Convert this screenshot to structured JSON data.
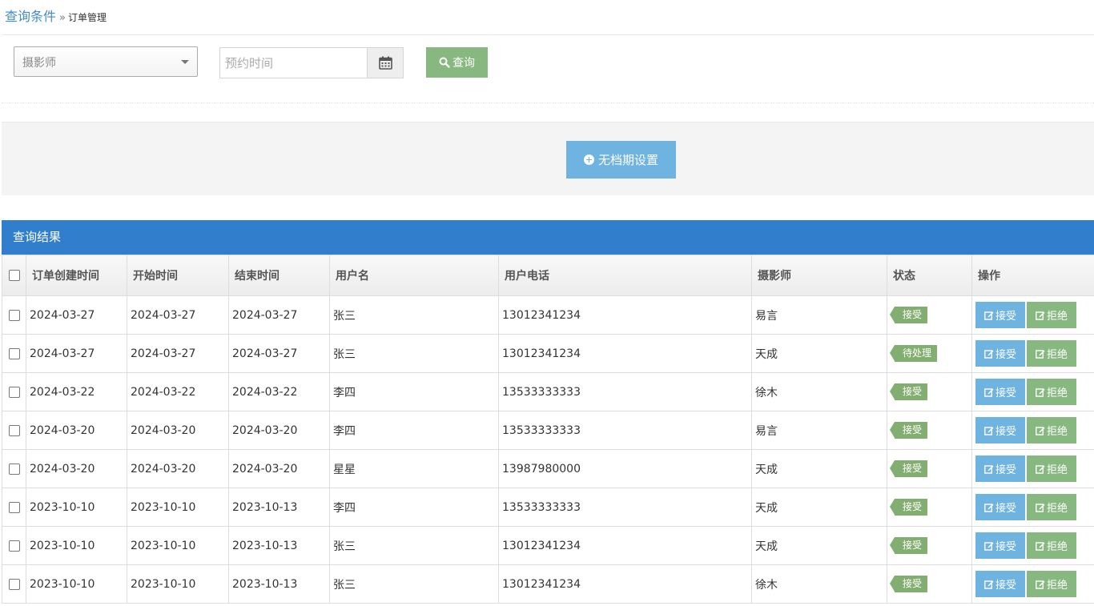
{
  "breadcrumb": {
    "main": "查询条件",
    "separator": "»",
    "sub": "订单管理"
  },
  "search": {
    "photographer_select": "摄影师",
    "date_placeholder": "预约时间",
    "query_label": "查询"
  },
  "toolbar": {
    "no_schedule_label": "无档期设置"
  },
  "results": {
    "title": "查询结果",
    "columns": [
      "订单创建时间",
      "开始时间",
      "结束时间",
      "用户名",
      "用户电话",
      "摄影师",
      "状态",
      "操作"
    ],
    "accept_label": "接受",
    "reject_label": "拒绝",
    "rows": [
      {
        "created": "2024-03-27",
        "start": "2024-03-27",
        "end": "2024-03-27",
        "user": "张三",
        "phone": "13012341234",
        "photographer": "易言",
        "status": "接受"
      },
      {
        "created": "2024-03-27",
        "start": "2024-03-27",
        "end": "2024-03-27",
        "user": "张三",
        "phone": "13012341234",
        "photographer": "天成",
        "status": "待处理"
      },
      {
        "created": "2024-03-22",
        "start": "2024-03-22",
        "end": "2024-03-22",
        "user": "李四",
        "phone": "13533333333",
        "photographer": "徐木",
        "status": "接受"
      },
      {
        "created": "2024-03-20",
        "start": "2024-03-20",
        "end": "2024-03-20",
        "user": "李四",
        "phone": "13533333333",
        "photographer": "易言",
        "status": "接受"
      },
      {
        "created": "2024-03-20",
        "start": "2024-03-20",
        "end": "2024-03-20",
        "user": "星星",
        "phone": "13987980000",
        "photographer": "天成",
        "status": "接受"
      },
      {
        "created": "2023-10-10",
        "start": "2023-10-10",
        "end": "2023-10-13",
        "user": "李四",
        "phone": "13533333333",
        "photographer": "天成",
        "status": "接受"
      },
      {
        "created": "2023-10-10",
        "start": "2023-10-10",
        "end": "2023-10-13",
        "user": "张三",
        "phone": "13012341234",
        "photographer": "天成",
        "status": "接受"
      },
      {
        "created": "2023-10-10",
        "start": "2023-10-10",
        "end": "2023-10-13",
        "user": "张三",
        "phone": "13012341234",
        "photographer": "徐木",
        "status": "接受"
      }
    ]
  },
  "colors": {
    "primary_blue": "#307ecc",
    "light_blue": "#6fb3e0",
    "success_green": "#87b87f",
    "status_green": "#82af6f",
    "link_blue": "#428bca"
  },
  "icons": {
    "calendar": "calendar-icon",
    "search": "search-icon",
    "plus": "plus-circle-icon",
    "edit": "edit-icon"
  }
}
